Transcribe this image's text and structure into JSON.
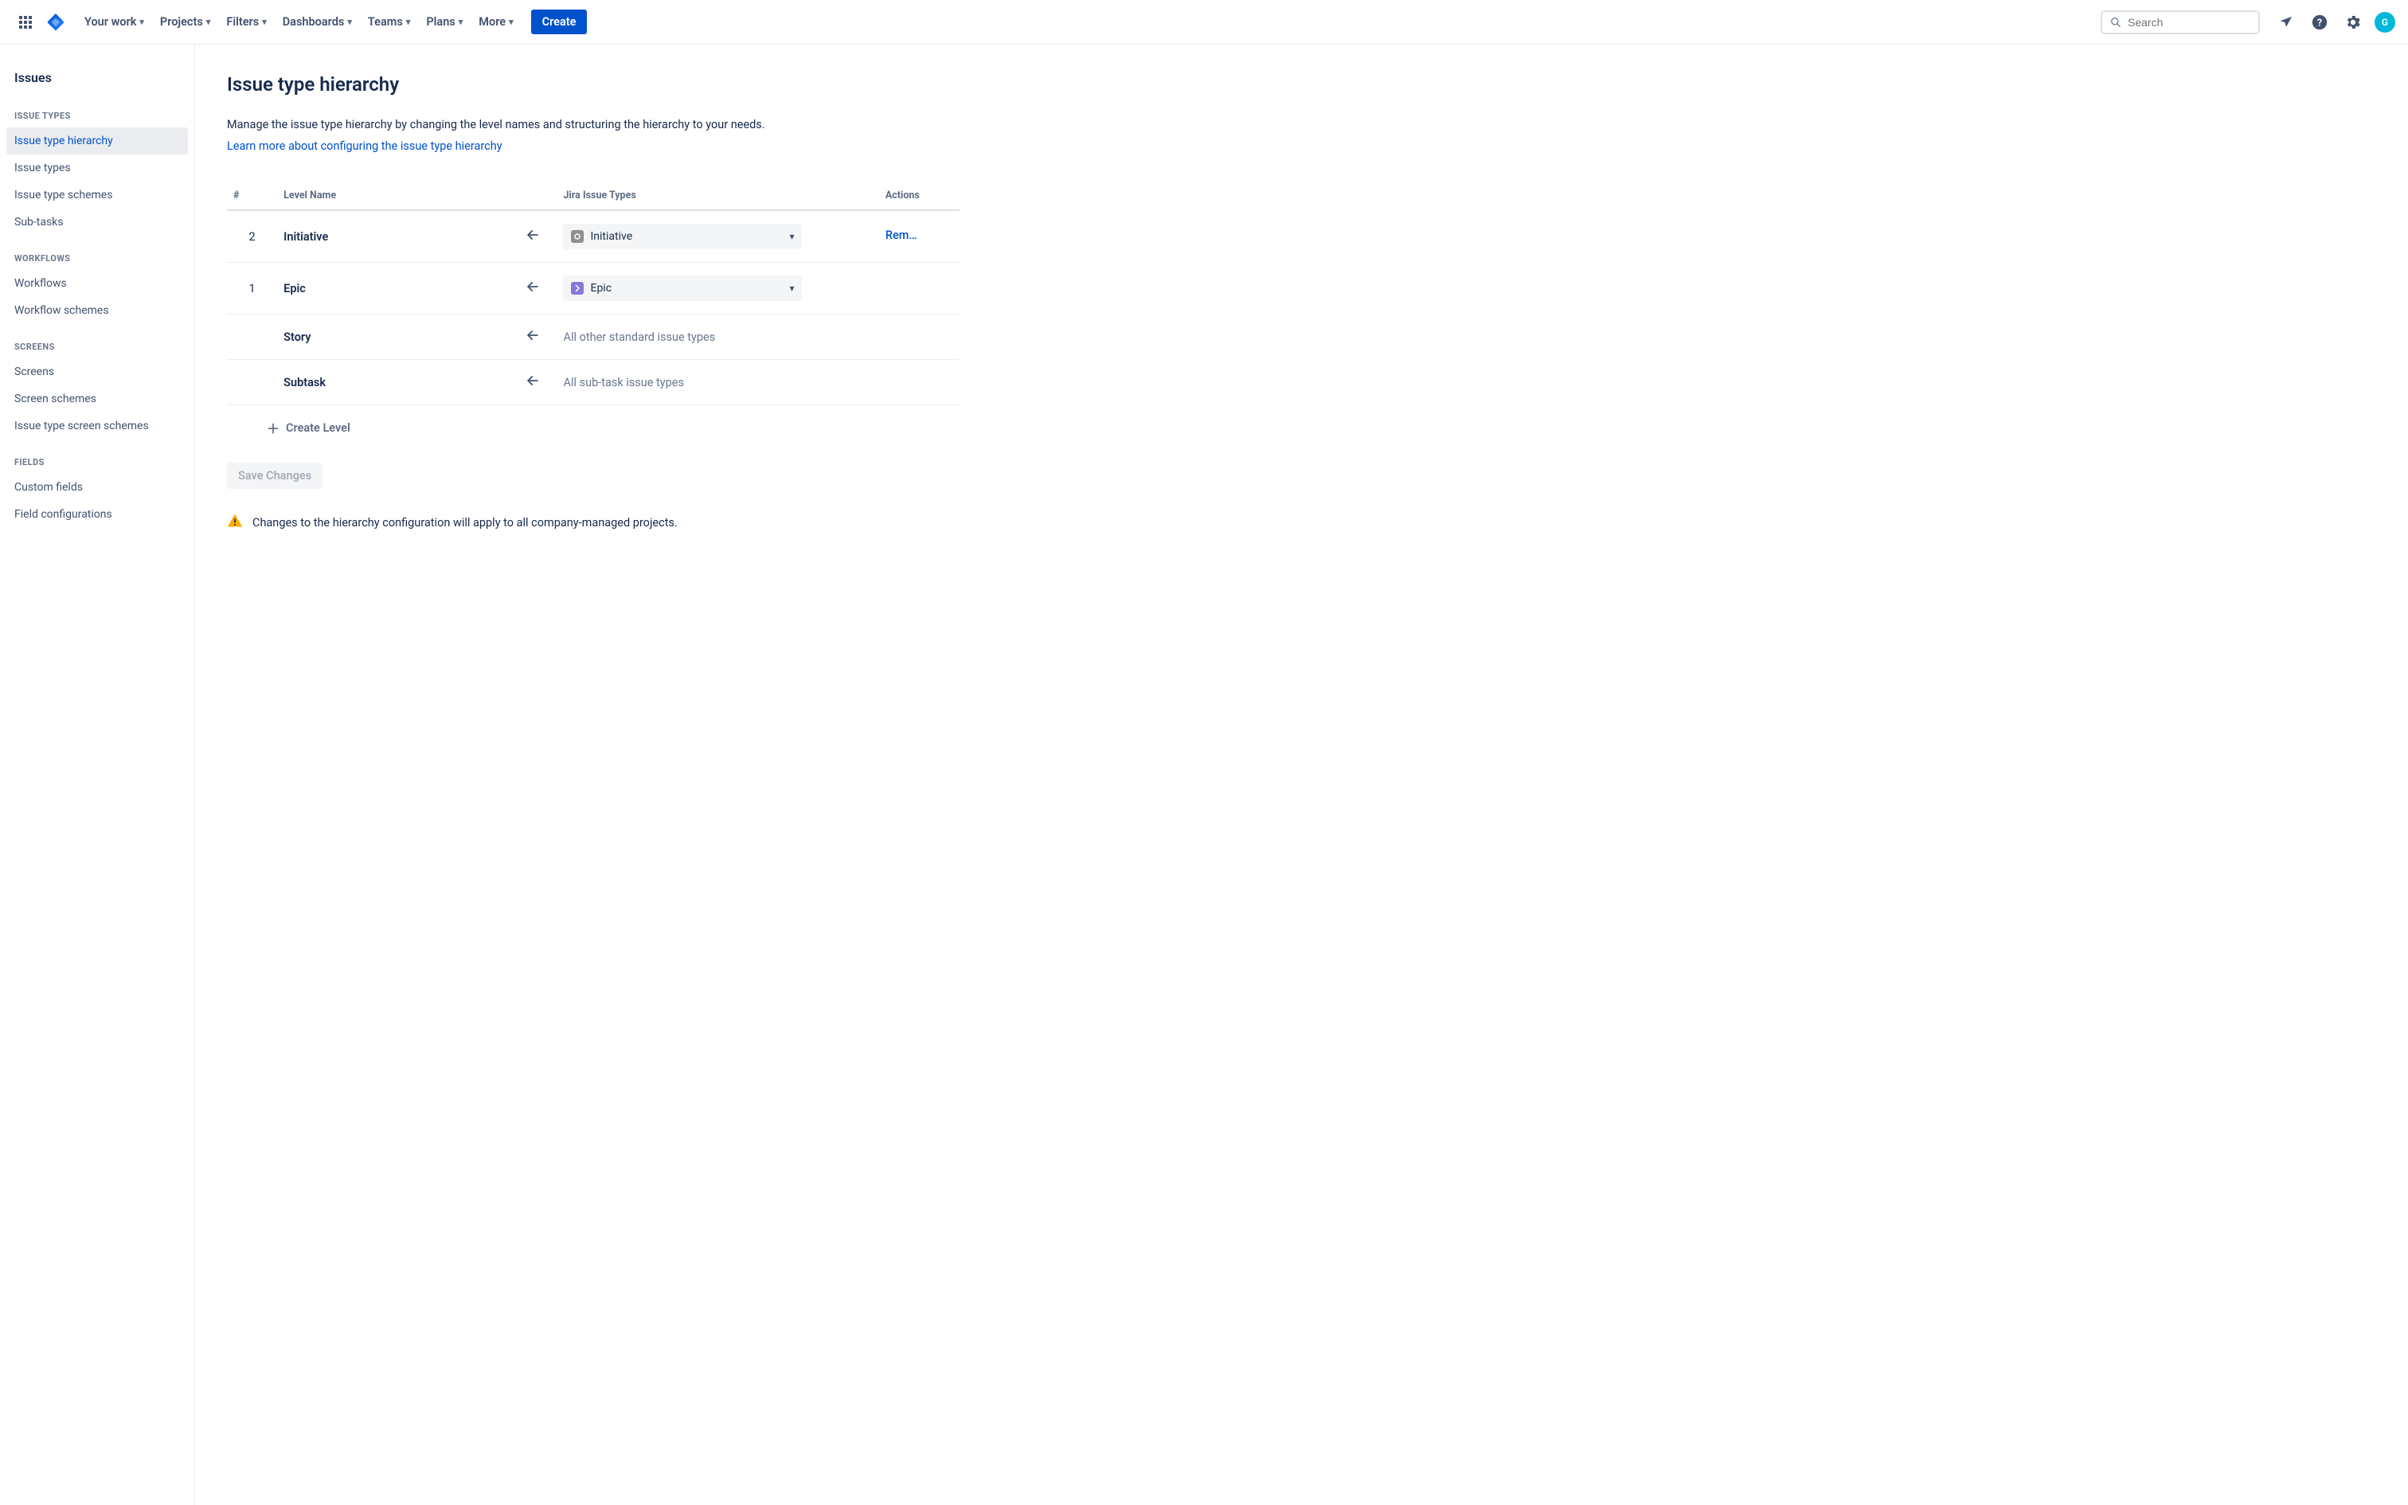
{
  "nav": {
    "items": [
      "Your work",
      "Projects",
      "Filters",
      "Dashboards",
      "Teams",
      "Plans",
      "More"
    ],
    "create_label": "Create",
    "search_placeholder": "Search",
    "avatar_initial": "G"
  },
  "sidebar": {
    "title": "Issues",
    "groups": [
      {
        "label": "ISSUE TYPES",
        "items": [
          "Issue type hierarchy",
          "Issue types",
          "Issue type schemes",
          "Sub-tasks"
        ],
        "active_index": 0
      },
      {
        "label": "WORKFLOWS",
        "items": [
          "Workflows",
          "Workflow schemes"
        ],
        "active_index": -1
      },
      {
        "label": "SCREENS",
        "items": [
          "Screens",
          "Screen schemes",
          "Issue type screen schemes"
        ],
        "active_index": -1
      },
      {
        "label": "FIELDS",
        "items": [
          "Custom fields",
          "Field configurations"
        ],
        "active_index": -1
      }
    ]
  },
  "page": {
    "title": "Issue type hierarchy",
    "lead": "Manage the issue type hierarchy by changing the level names and structuring the hierarchy to your needs.",
    "learn_more": "Learn more about configuring the issue type hierarchy",
    "columns": {
      "num": "#",
      "name": "Level Name",
      "types": "Jira Issue Types",
      "actions": "Actions"
    },
    "rows": [
      {
        "num": "2",
        "name": "Initiative",
        "has_arrow": true,
        "select": {
          "icon": "initiative",
          "label": "Initiative"
        },
        "type_text": "",
        "action": "Rem…"
      },
      {
        "num": "1",
        "name": "Epic",
        "has_arrow": true,
        "select": {
          "icon": "epic",
          "label": "Epic"
        },
        "type_text": "",
        "action": ""
      },
      {
        "num": "",
        "name": "Story",
        "has_arrow": true,
        "select": null,
        "type_text": "All other standard issue types",
        "action": ""
      },
      {
        "num": "",
        "name": "Subtask",
        "has_arrow": true,
        "select": null,
        "type_text": "All sub-task issue types",
        "action": ""
      }
    ],
    "create_level": "Create Level",
    "save_changes": "Save Changes",
    "warning": "Changes to the hierarchy configuration will apply to all company-managed projects."
  }
}
